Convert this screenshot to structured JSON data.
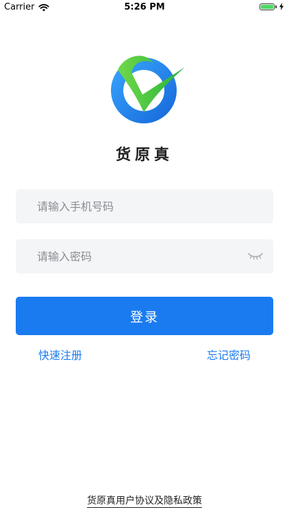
{
  "status_bar": {
    "carrier": "Carrier",
    "time": "5:26 PM",
    "battery_level": 1.0,
    "battery_color": "#4cd964"
  },
  "app": {
    "name": "货原真",
    "logo_icon": "check-circle-logo-icon",
    "logo_ring_color": "#1f8ef5",
    "logo_check_color": "#3ec23a"
  },
  "login_form": {
    "phone_placeholder": "请输入手机号码",
    "phone_value": "",
    "password_placeholder": "请输入密码",
    "password_value": "",
    "password_toggle_icon": "eye-closed-icon",
    "login_label": "登录",
    "register_label": "快速注册",
    "forgot_label": "忘记密码",
    "accent_color": "#1a7bf0"
  },
  "footer": {
    "policy_label": "货原真用户协议及隐私政策"
  }
}
